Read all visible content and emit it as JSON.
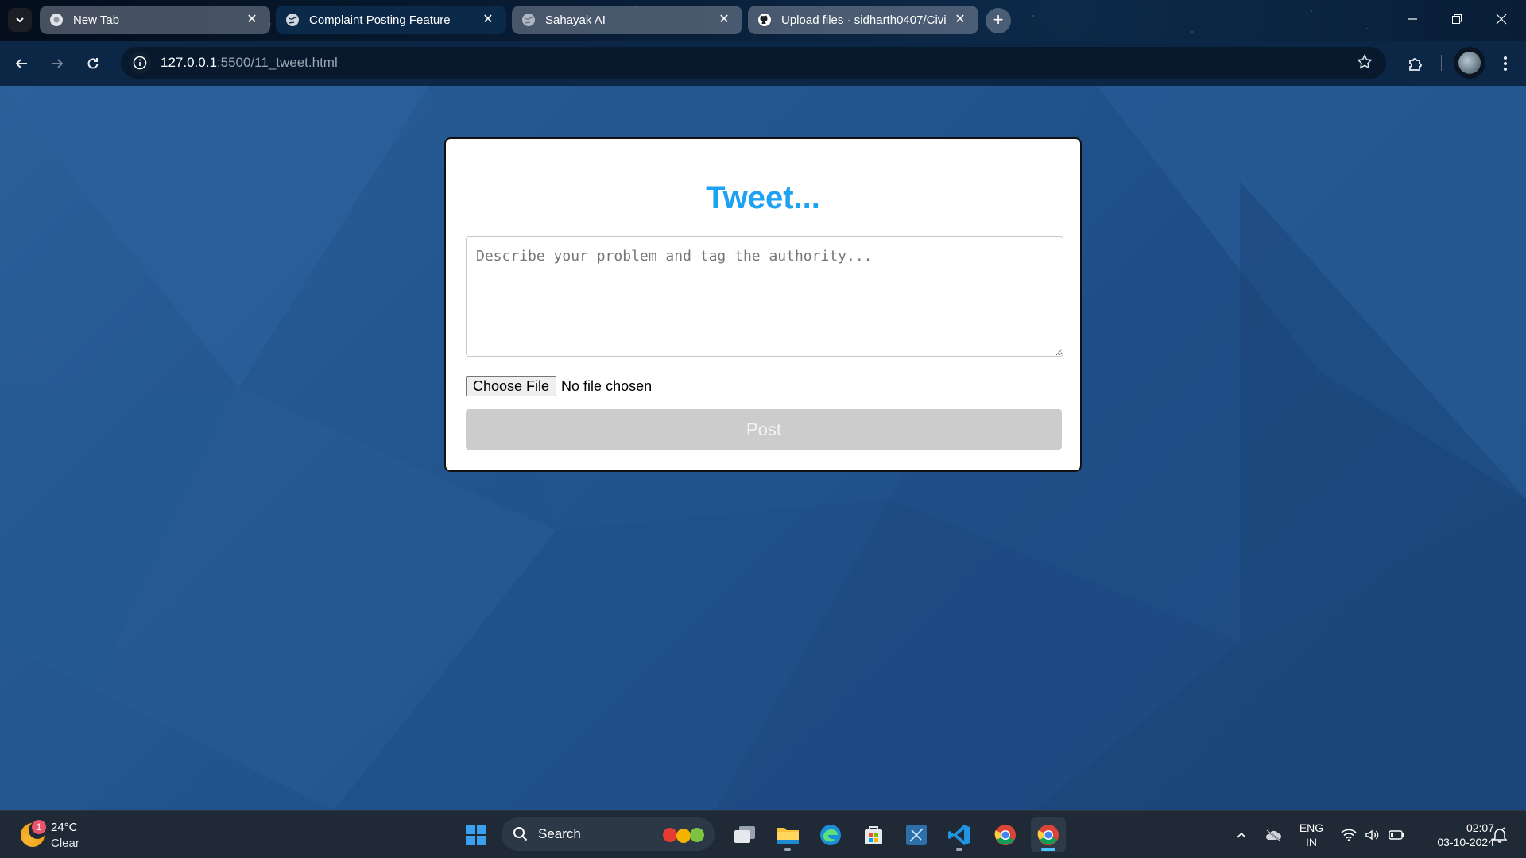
{
  "browser": {
    "tabs": [
      {
        "title": "New Tab",
        "favicon": "chrome-icon",
        "active": false
      },
      {
        "title": "Complaint Posting Feature",
        "favicon": "globe-icon",
        "active": true
      },
      {
        "title": "Sahayak AI",
        "favicon": "globe-icon",
        "active": false
      },
      {
        "title": "Upload files · sidharth0407/Civi",
        "favicon": "github-icon",
        "active": false
      }
    ],
    "url_host": "127.0.0.1",
    "url_path": ":5500/11_tweet.html"
  },
  "page": {
    "heading": "Tweet...",
    "textarea_placeholder": "Describe your problem and tag the authority...",
    "choose_file_label": "Choose File",
    "file_status": "No file chosen",
    "post_label": "Post",
    "colors": {
      "heading": "#1da1f2",
      "post_disabled": "#cccccc"
    }
  },
  "taskbar": {
    "weather": {
      "badge": "1",
      "temperature": "24°C",
      "condition": "Clear"
    },
    "search_label": "Search",
    "language_line1": "ENG",
    "language_line2": "IN",
    "time": "02:07",
    "date": "03-10-2024"
  }
}
